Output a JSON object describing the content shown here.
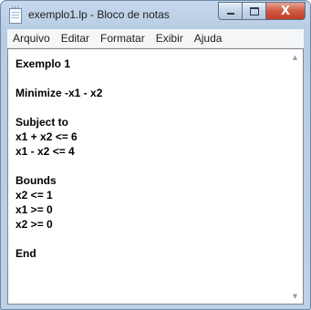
{
  "window": {
    "title": "exemplo1.lp - Bloco de notas",
    "buttons": {
      "minimize_icon": "minimize-icon",
      "maximize_icon": "maximize-icon",
      "close_label": "X"
    }
  },
  "menu": [
    "Arquivo",
    "Editar",
    "Formatar",
    "Exibir",
    "Ajuda"
  ],
  "editor": {
    "lines": [
      "Exemplo 1",
      "",
      "Minimize -x1 - x2",
      "",
      "Subject to",
      "x1 + x2 <= 6",
      "x1 - x2 <= 4",
      "",
      "Bounds",
      "x2 <= 1",
      "x1 >= 0",
      "x2 >= 0",
      "",
      "End"
    ]
  },
  "scrollbar": {
    "up_icon": "scroll-up-arrow-icon",
    "down_icon": "scroll-down-arrow-icon"
  }
}
